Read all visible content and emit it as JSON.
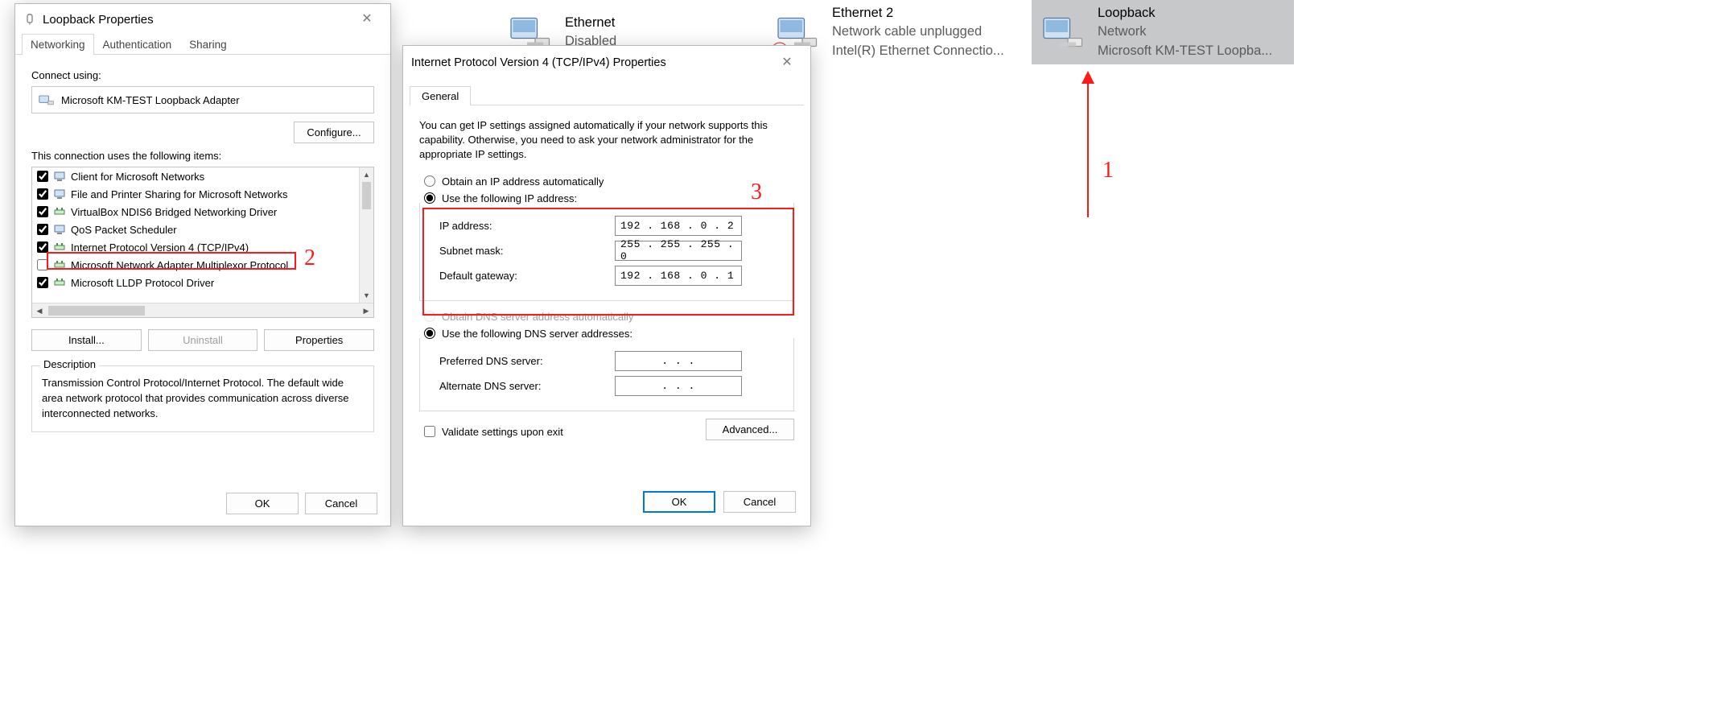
{
  "adapters": {
    "ethernet": {
      "name": "Ethernet",
      "status": "Disabled",
      "desc": ""
    },
    "ethernet2": {
      "name": "Ethernet 2",
      "status": "Network cable unplugged",
      "desc": "Intel(R) Ethernet Connectio..."
    },
    "loopback": {
      "name": "Loopback",
      "status": "Network",
      "desc": "Microsoft KM-TEST Loopba..."
    }
  },
  "win1": {
    "title": "Loopback Properties",
    "tabs": {
      "networking": "Networking",
      "authentication": "Authentication",
      "sharing": "Sharing"
    },
    "connect_using_label": "Connect using:",
    "adapter_name": "Microsoft KM-TEST Loopback Adapter",
    "configure_btn": "Configure...",
    "items_label": "This connection uses the following items:",
    "items": [
      {
        "checked": true,
        "label": "Client for Microsoft Networks"
      },
      {
        "checked": true,
        "label": "File and Printer Sharing for Microsoft Networks"
      },
      {
        "checked": true,
        "label": "VirtualBox NDIS6 Bridged Networking Driver"
      },
      {
        "checked": true,
        "label": "QoS Packet Scheduler"
      },
      {
        "checked": true,
        "label": "Internet Protocol Version 4 (TCP/IPv4)"
      },
      {
        "checked": false,
        "label": "Microsoft Network Adapter Multiplexor Protocol"
      },
      {
        "checked": true,
        "label": "Microsoft LLDP Protocol Driver"
      }
    ],
    "install_btn": "Install...",
    "uninstall_btn": "Uninstall",
    "properties_btn": "Properties",
    "desc_title": "Description",
    "desc_text": "Transmission Control Protocol/Internet Protocol. The default wide area network protocol that provides communication across diverse interconnected networks.",
    "ok": "OK",
    "cancel": "Cancel"
  },
  "win2": {
    "title": "Internet Protocol Version 4 (TCP/IPv4) Properties",
    "tab_general": "General",
    "explain": "You can get IP settings assigned automatically if your network supports this capability. Otherwise, you need to ask your network administrator for the appropriate IP settings.",
    "radio_auto_ip": "Obtain an IP address automatically",
    "radio_static_ip": "Use the following IP address:",
    "ip_label": "IP address:",
    "ip_value": "192 . 168 .  0  .  2",
    "mask_label": "Subnet mask:",
    "mask_value": "255 . 255 . 255 .  0",
    "gw_label": "Default gateway:",
    "gw_value": "192 . 168 .  0  .  1",
    "radio_auto_dns": "Obtain DNS server address automatically",
    "radio_static_dns": "Use the following DNS server addresses:",
    "pref_dns_label": "Preferred DNS server:",
    "alt_dns_label": "Alternate DNS server:",
    "dns_empty": ".          .          .",
    "validate_label": "Validate settings upon exit",
    "advanced_btn": "Advanced...",
    "ok": "OK",
    "cancel": "Cancel"
  },
  "annotations": {
    "n1": "1",
    "n2": "2",
    "n3": "3"
  }
}
